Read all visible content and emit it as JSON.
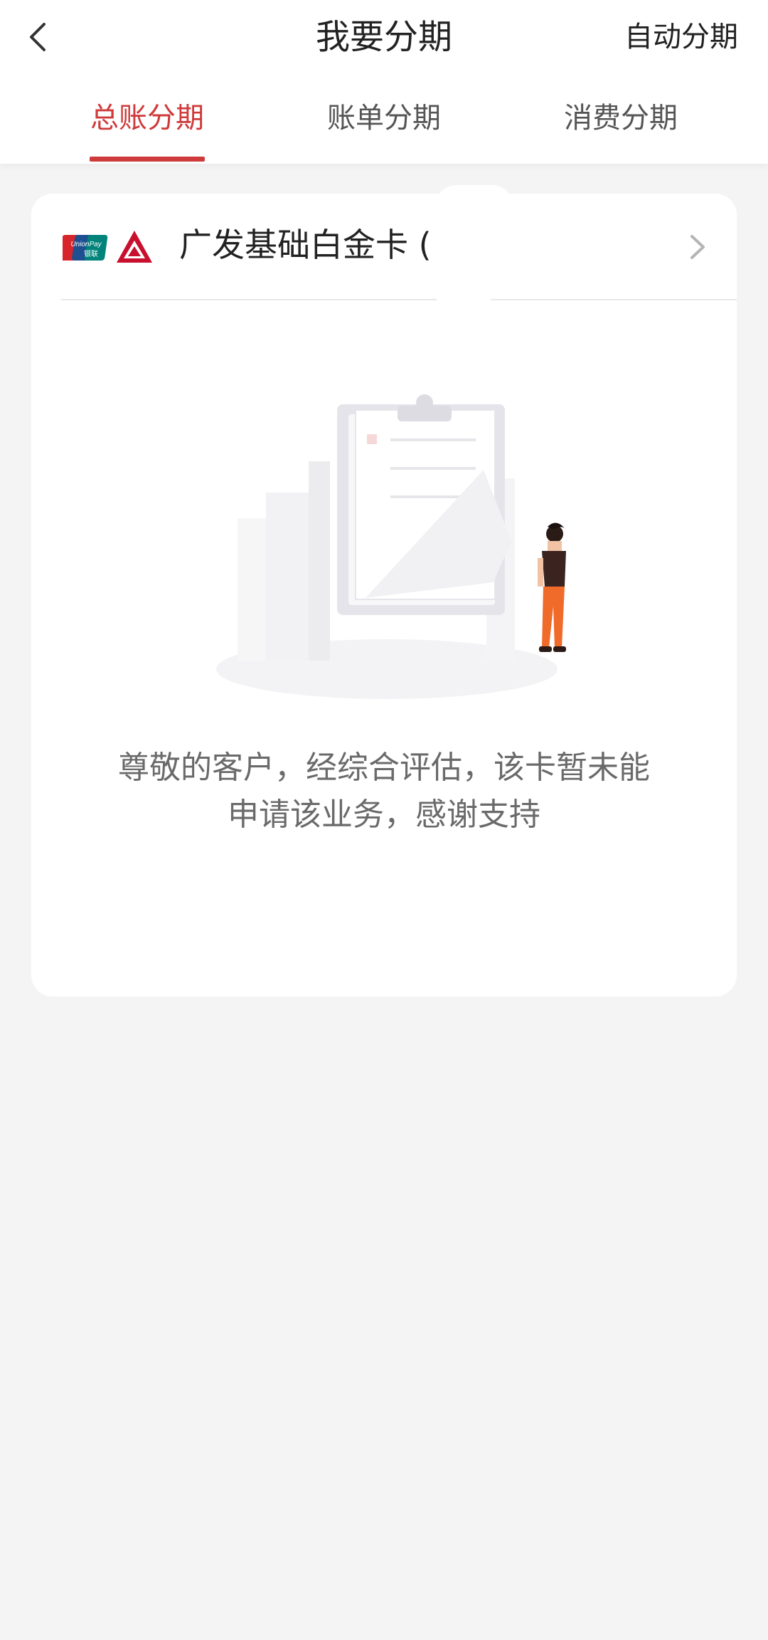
{
  "nav": {
    "title": "我要分期",
    "action_label": "自动分期",
    "back_icon": "chevron-left-icon"
  },
  "tabs": [
    {
      "label": "总账分期",
      "active": true
    },
    {
      "label": "账单分期",
      "active": false
    },
    {
      "label": "消费分期",
      "active": false
    }
  ],
  "card": {
    "name": "广发基础白金卡 (",
    "logos": [
      "unionpay-logo",
      "cgb-bank-logo"
    ],
    "arrow_icon": "chevron-right-icon"
  },
  "empty_state": {
    "illustration": "clipboard-person-illustration",
    "line1": "尊敬的客户，经综合评估，该卡暂未能",
    "line2": "申请该业务，感谢支持"
  },
  "colors": {
    "accent": "#cf3a3a",
    "background": "#f4f4f5",
    "card": "#ffffff",
    "text_primary": "#222222",
    "text_secondary": "#6a6a6a"
  }
}
